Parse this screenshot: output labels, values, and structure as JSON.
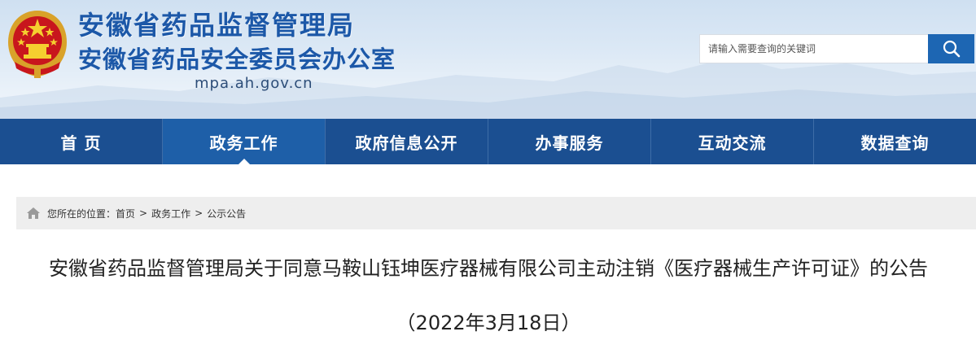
{
  "header": {
    "title": "安徽省药品监督管理局",
    "subtitle": "安徽省药品安全委员会办公室",
    "domain": "mpa.ah.gov.cn",
    "emblem_icon": "national-emblem-icon"
  },
  "search": {
    "placeholder": "请输入需要查询的关键词",
    "value": "",
    "button_icon": "search-icon"
  },
  "nav": {
    "items": [
      {
        "label": "首 页",
        "active": false
      },
      {
        "label": "政务工作",
        "active": true
      },
      {
        "label": "政府信息公开",
        "active": false
      },
      {
        "label": "办事服务",
        "active": false
      },
      {
        "label": "互动交流",
        "active": false
      },
      {
        "label": "数据查询",
        "active": false
      }
    ]
  },
  "breadcrumb": {
    "icon": "home-icon",
    "prefix": "您所在的位置：",
    "items": [
      "首页",
      "政务工作",
      "公示公告"
    ],
    "separator": ">"
  },
  "article": {
    "title": "安徽省药品监督管理局关于同意马鞍山钰坤医疗器械有限公司主动注销《医疗器械生产许可证》的公告",
    "date": "（2022年3月18日）"
  },
  "colors": {
    "brand_blue": "#1c58a8",
    "nav_bg": "#1b4f91",
    "nav_active_bg": "#1e5fa8",
    "search_button": "#1d66b3",
    "breadcrumb_bg": "#eeeeee"
  }
}
